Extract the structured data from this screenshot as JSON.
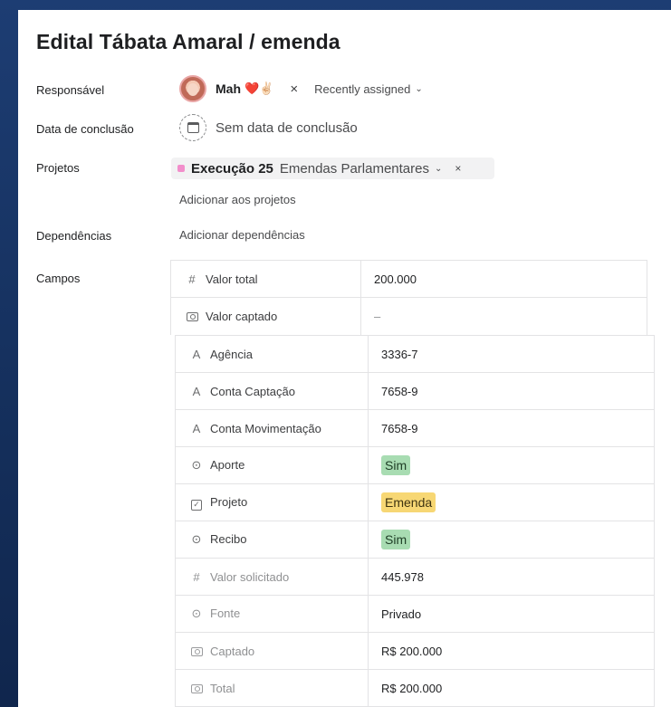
{
  "task": {
    "title": "Edital Tábata Amaral / emenda"
  },
  "labels": {
    "assignee": "Responsável",
    "due_date": "Data de conclusão",
    "projects": "Projetos",
    "dependencies": "Dependências",
    "fields": "Campos"
  },
  "assignee": {
    "name": "Mah",
    "emoji": "❤️✌🏻",
    "remove": "×",
    "recent": "Recently assigned"
  },
  "due_date": {
    "text": "Sem data de conclusão"
  },
  "project": {
    "name": "Execução 25",
    "section": "Emendas Parlamentares",
    "color": "#f28ecb",
    "remove": "×",
    "add_link": "Adicionar aos projetos"
  },
  "dependencies": {
    "add_link": "Adicionar dependências"
  },
  "fields_top": [
    {
      "icon": "#",
      "name": "Valor total",
      "value": "200.000"
    },
    {
      "icon": "money",
      "name": "Valor captado",
      "value": "–"
    }
  ],
  "fields_bottom": [
    {
      "icon": "A",
      "name": "Agência",
      "value": "3336-7"
    },
    {
      "icon": "A",
      "name": "Conta Captação",
      "value": "7658-9"
    },
    {
      "icon": "A",
      "name": "Conta Movimentação",
      "value": "7658-9"
    },
    {
      "icon": "⊙",
      "name": "Aporte",
      "value": "Sim",
      "badge_color": "#a8dcb2"
    },
    {
      "icon": "check",
      "name": "Projeto",
      "value": "Emenda",
      "badge_color": "#f7d774"
    },
    {
      "icon": "⊙",
      "name": "Recibo",
      "value": "Sim",
      "badge_color": "#a8dcb2"
    },
    {
      "icon": "#",
      "name": "Valor solicitado",
      "value": "445.978"
    },
    {
      "icon": "⊙",
      "name": "Fonte",
      "value": "Privado"
    },
    {
      "icon": "money",
      "name": "Captado",
      "value": "R$ 200.000"
    },
    {
      "icon": "money",
      "name": "Total",
      "value": "R$ 200.000"
    }
  ]
}
